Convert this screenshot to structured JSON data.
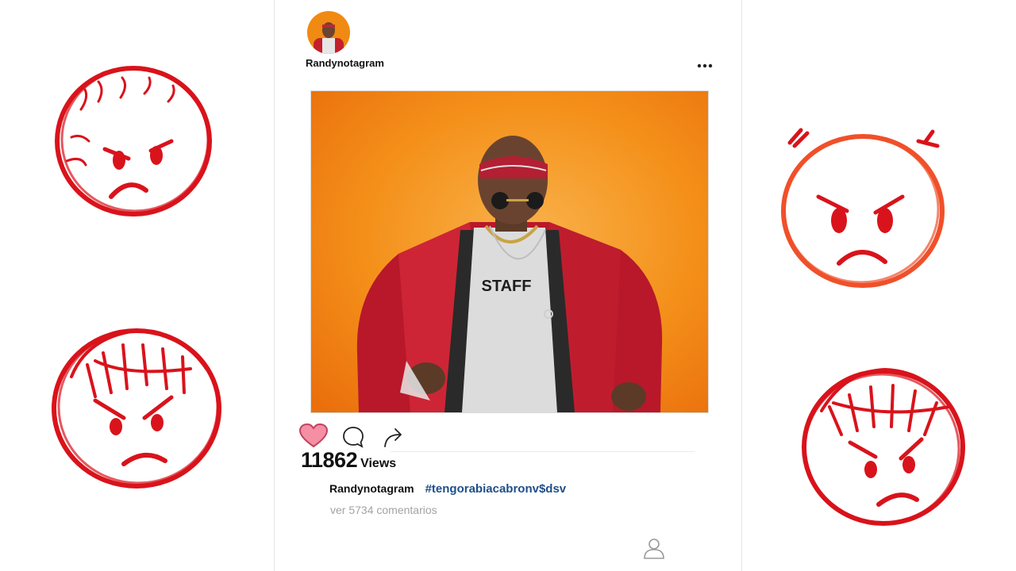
{
  "post": {
    "username": "Randynotagram",
    "shirt_text": "STAFF",
    "views_count": "11862",
    "views_label": "Views",
    "caption_user": "Randynotagram",
    "hashtag": "#tengorabiacabronv$dsv",
    "comments_link": "ver 5734 comentarios",
    "liked": true
  },
  "icons": {
    "more": "more-options-icon",
    "like": "heart-icon",
    "comment": "comment-bubble-icon",
    "share": "share-arrow-icon",
    "profile": "profile-person-icon"
  },
  "colors": {
    "heart_fill": "#f48fa4",
    "hashtag": "#1e4f8a",
    "photo_bg": "#f08a12",
    "doodle_red": "#d9131b",
    "doodle_orange": "#f0502a"
  }
}
